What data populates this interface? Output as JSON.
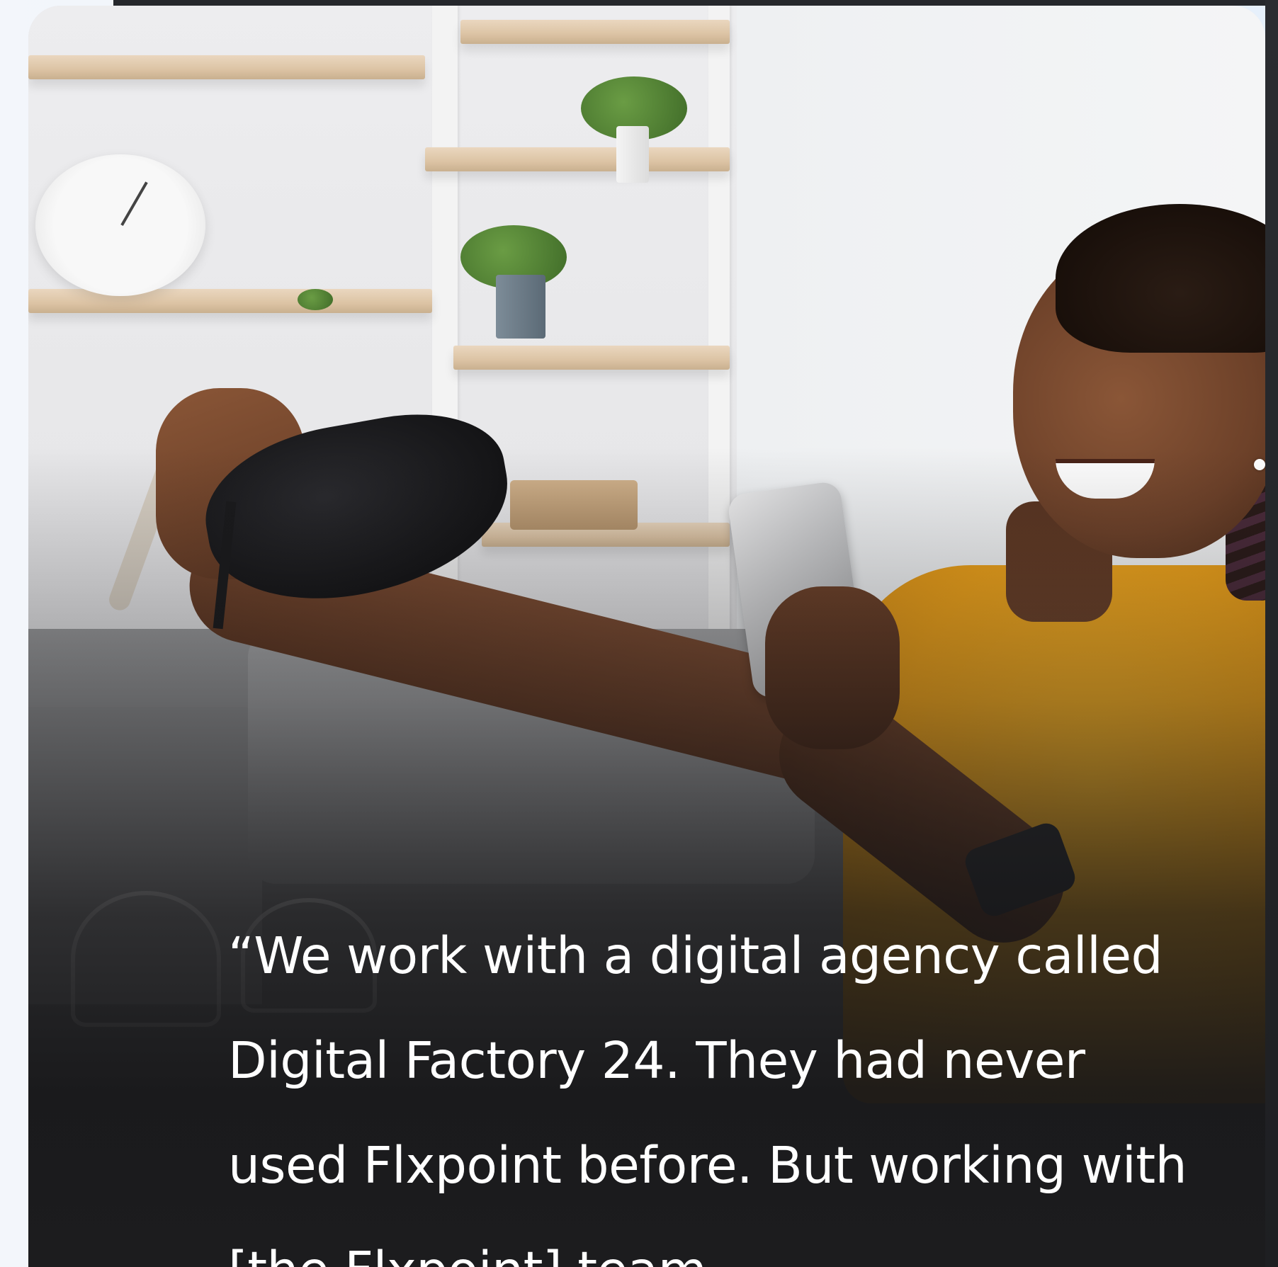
{
  "testimonial": {
    "quote": "“We work with a digital agency called Digital Factory 24. They had never used Flxpoint before. But working with [the Flxpoint] team"
  },
  "photo": {
    "subject": "woman-holding-shoe-and-phone",
    "accent_shirt_color": "#eea21a",
    "overlay_color": "#1c1c1e"
  },
  "icons": {
    "clock": "wall-clock",
    "plant": "potted-plant"
  }
}
